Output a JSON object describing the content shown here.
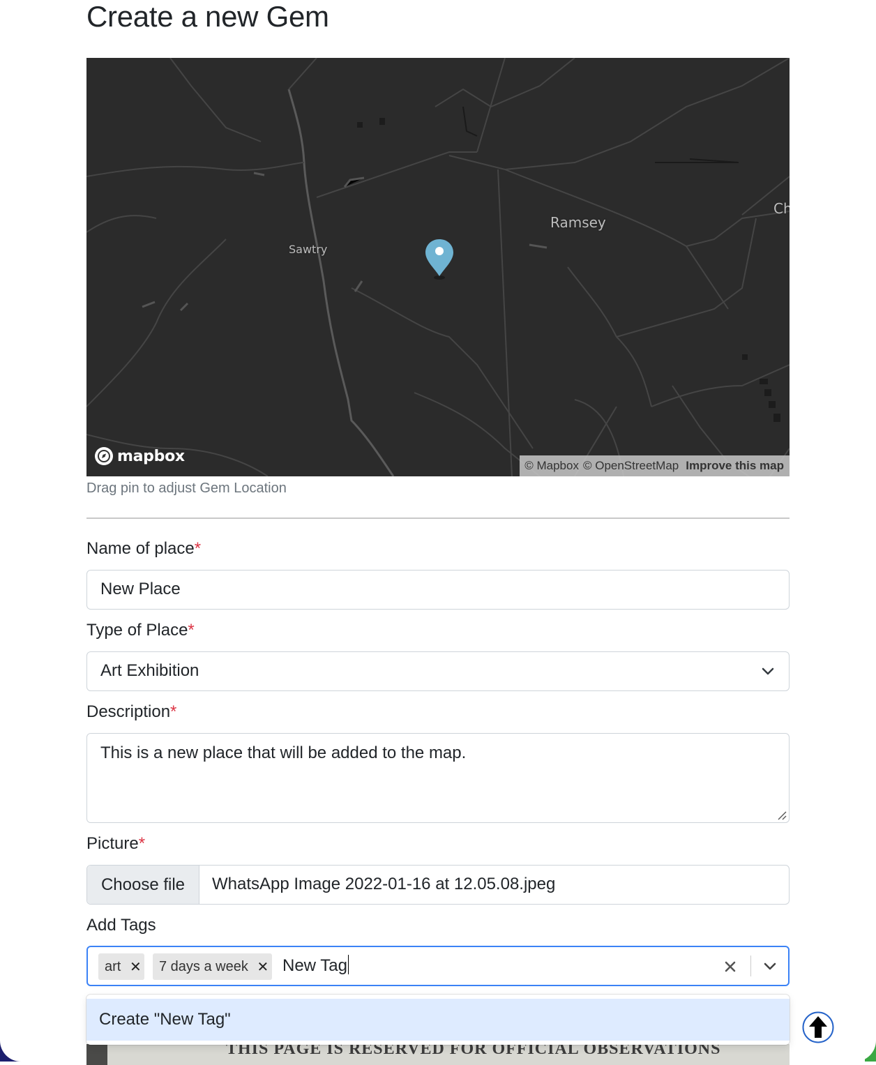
{
  "page": {
    "title": "Create a new Gem"
  },
  "map": {
    "labels": {
      "ramsey": "Ramsey",
      "sawtry": "Sawtry",
      "ch": "Ch"
    },
    "logo_text": "mapbox",
    "attribution": {
      "mapbox": "© Mapbox",
      "osm": "© OpenStreetMap",
      "improve": "Improve this map"
    },
    "help_text": "Drag pin to adjust Gem Location",
    "pin_color": "#6fb3d2",
    "background_color": "#2b2b2b"
  },
  "form": {
    "required_mark": "*",
    "name": {
      "label": "Name of place",
      "value": "New Place"
    },
    "type": {
      "label": "Type of Place",
      "value": "Art Exhibition"
    },
    "description": {
      "label": "Description",
      "value": "This is a new place that will be added to the map."
    },
    "picture": {
      "label": "Picture",
      "button": "Choose file",
      "file_name": "WhatsApp Image 2022-01-16 at 12.05.08.jpeg"
    },
    "tags": {
      "label": "Add Tags",
      "selected": [
        "art",
        "7 days a week"
      ],
      "input_value": "New Tag",
      "create_option": "Create \"New Tag\"",
      "focus_color": "#3b82f6",
      "option_highlight_color": "#deebff"
    }
  },
  "preview_image": {
    "text": "THIS PAGE IS RESERVED FOR OFFICIAL OBSERVATIONS"
  },
  "colors": {
    "required": "#dc3545",
    "muted": "#6c757d"
  },
  "icons": {
    "map_pin": "map-pin-icon",
    "select_arrow": "chevron-down-icon",
    "chip_remove": "close-icon",
    "clear": "close-icon",
    "scroll_top": "arrow-up-icon"
  }
}
